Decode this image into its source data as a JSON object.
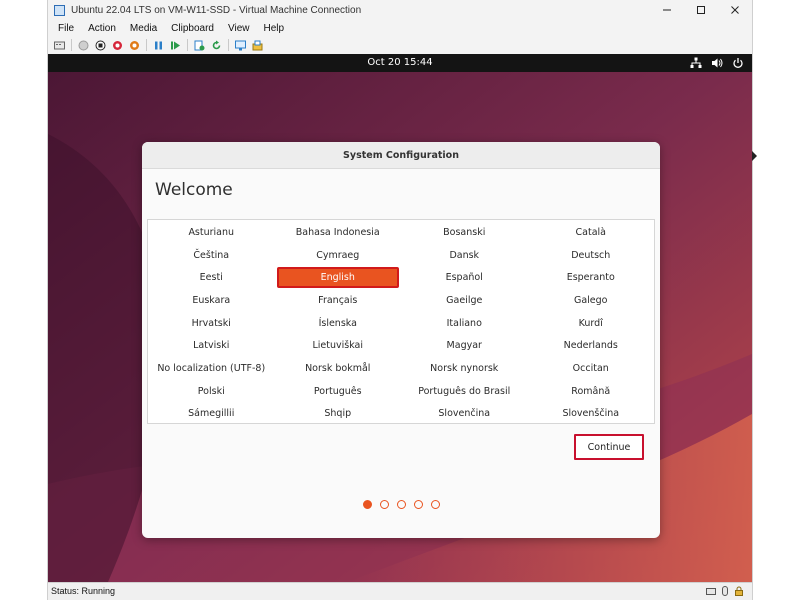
{
  "host_window": {
    "title": "Ubuntu 22.04 LTS on VM-W11-SSD - Virtual Machine Connection",
    "app_icon": "hyperv-connection-icon",
    "controls": [
      "minimize-icon",
      "maximize-icon",
      "close-icon"
    ],
    "menus": [
      "File",
      "Action",
      "Media",
      "Clipboard",
      "View",
      "Help"
    ],
    "toolbar_icons": [
      "ctrl-alt-del-icon",
      "start-icon",
      "turn-off-icon",
      "shut-down-icon",
      "save-icon",
      "pause-icon",
      "resume-icon",
      "checkpoint-icon",
      "revert-icon",
      "enhanced-session-icon",
      "share-icon"
    ],
    "status": "Status: Running",
    "status_icons": [
      "keyboard-icon",
      "mouse-icon",
      "lock-icon"
    ]
  },
  "guest": {
    "clock": "Oct 20  15:44",
    "tray_icons": [
      "network-icon",
      "volume-icon",
      "power-icon"
    ],
    "colors": {
      "accent": "#e95420",
      "topbar": "#141414",
      "wallpaper": "#5b1f3e"
    }
  },
  "dialog": {
    "title": "System Configuration",
    "heading": "Welcome",
    "languages": [
      "Asturianu",
      "Bahasa Indonesia",
      "Bosanski",
      "Català",
      "Čeština",
      "Cymraeg",
      "Dansk",
      "Deutsch",
      "Eesti",
      "English",
      "Español",
      "Esperanto",
      "Euskara",
      "Français",
      "Gaeilge",
      "Galego",
      "Hrvatski",
      "Íslenska",
      "Italiano",
      "Kurdî",
      "Latviski",
      "Lietuviškai",
      "Magyar",
      "Nederlands",
      "No localization (UTF-8)",
      "Norsk bokmål",
      "Norsk nynorsk",
      "Occitan",
      "Polski",
      "Português",
      "Português do Brasil",
      "Română",
      "Sámegillii",
      "Shqip",
      "Slovenčina",
      "Slovenščina"
    ],
    "selected_language": "English",
    "continue_label": "Continue",
    "pagination": {
      "total": 5,
      "current": 1
    }
  }
}
